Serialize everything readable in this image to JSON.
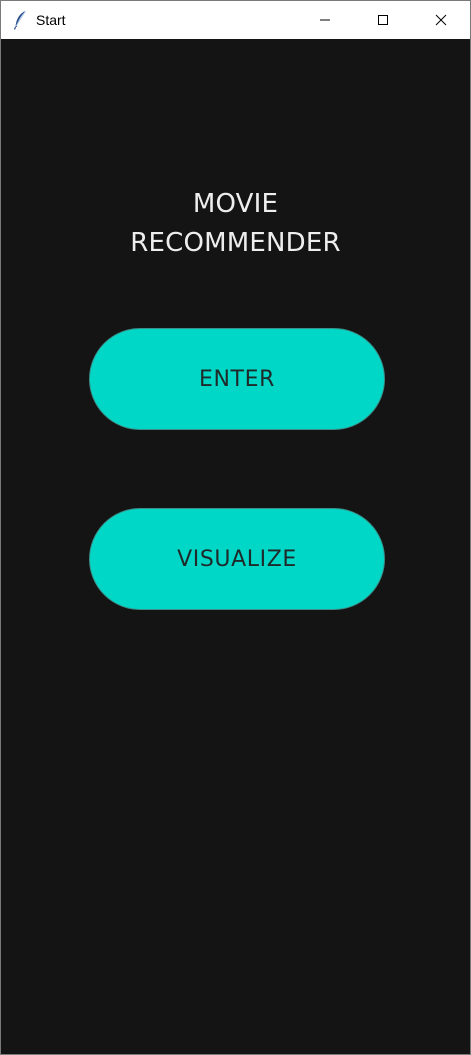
{
  "window": {
    "title": "Start",
    "app_icon": "feather-icon",
    "controls": [
      "minimize-icon",
      "maximize-icon",
      "close-icon"
    ]
  },
  "main": {
    "title_line1": "MOVIE",
    "title_line2": "RECOMMENDER",
    "enter_label": "ENTER",
    "visualize_label": "VISUALIZE"
  },
  "colors": {
    "background": "#141414",
    "accent": "#00d7c7",
    "title_text": "#eeeeee",
    "button_text": "#1e2a2a"
  }
}
